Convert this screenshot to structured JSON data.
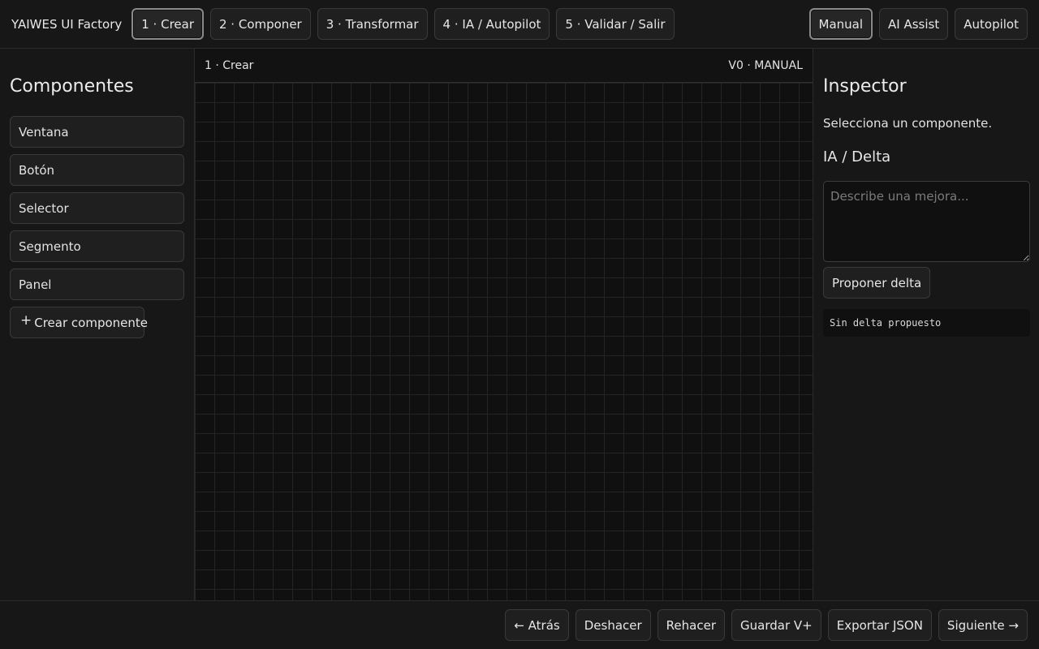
{
  "app": {
    "title": "YAIWES UI Factory"
  },
  "steps": [
    {
      "label": "1 · Crear",
      "active": true
    },
    {
      "label": "2 · Componer",
      "active": false
    },
    {
      "label": "3 · Transformar",
      "active": false
    },
    {
      "label": "4 · IA / Autopilot",
      "active": false
    },
    {
      "label": "5 · Validar / Salir",
      "active": false
    }
  ],
  "modes": [
    {
      "label": "Manual",
      "active": true
    },
    {
      "label": "AI Assist",
      "active": false
    },
    {
      "label": "Autopilot",
      "active": false
    }
  ],
  "sidebar": {
    "title": "Componentes",
    "items": [
      {
        "label": "Ventana"
      },
      {
        "label": "Botón"
      },
      {
        "label": "Selector"
      },
      {
        "label": "Segmento"
      },
      {
        "label": "Panel"
      }
    ],
    "create": {
      "icon": "plus-icon",
      "label": "Crear componente"
    }
  },
  "canvas": {
    "step_label": "1 · Crear",
    "status": "V0 · MANUAL"
  },
  "inspector": {
    "title": "Inspector",
    "hint": "Selecciona un componente.",
    "ai_title": "IA / Delta",
    "input_placeholder": "Describe una mejora...",
    "input_value": "",
    "propose_label": "Proponer delta",
    "delta_output": "Sin delta propuesto"
  },
  "footer": {
    "back": "← Atrás",
    "undo": "Deshacer",
    "redo": "Rehacer",
    "save": "Guardar V+",
    "export": "Exportar JSON",
    "next": "Siguiente →"
  },
  "colors": {
    "background": "#161616",
    "canvas": "#101010",
    "grid": "#242424",
    "border": "#3a3a3a",
    "active_border": "#8a8a8a"
  }
}
